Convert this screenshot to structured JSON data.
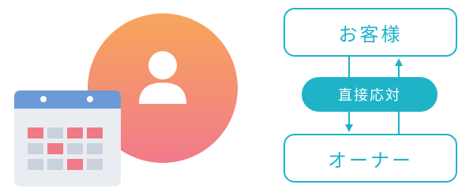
{
  "diagram": {
    "top_node": "お客様",
    "middle_node": "直接応対",
    "bottom_node": "オーナー"
  },
  "icons": [
    {
      "name": "calendar-icon",
      "colors": {
        "header": "#6b9ad6",
        "body": "#e9edf2",
        "cell": "#c9d2dc",
        "highlight": "#f07a86"
      }
    },
    {
      "name": "person-icon",
      "colors": {
        "gradient_top": "#f6a65b",
        "gradient_bottom": "#f27a8b"
      }
    }
  ],
  "colors": {
    "accent": "#1fb3c8"
  }
}
